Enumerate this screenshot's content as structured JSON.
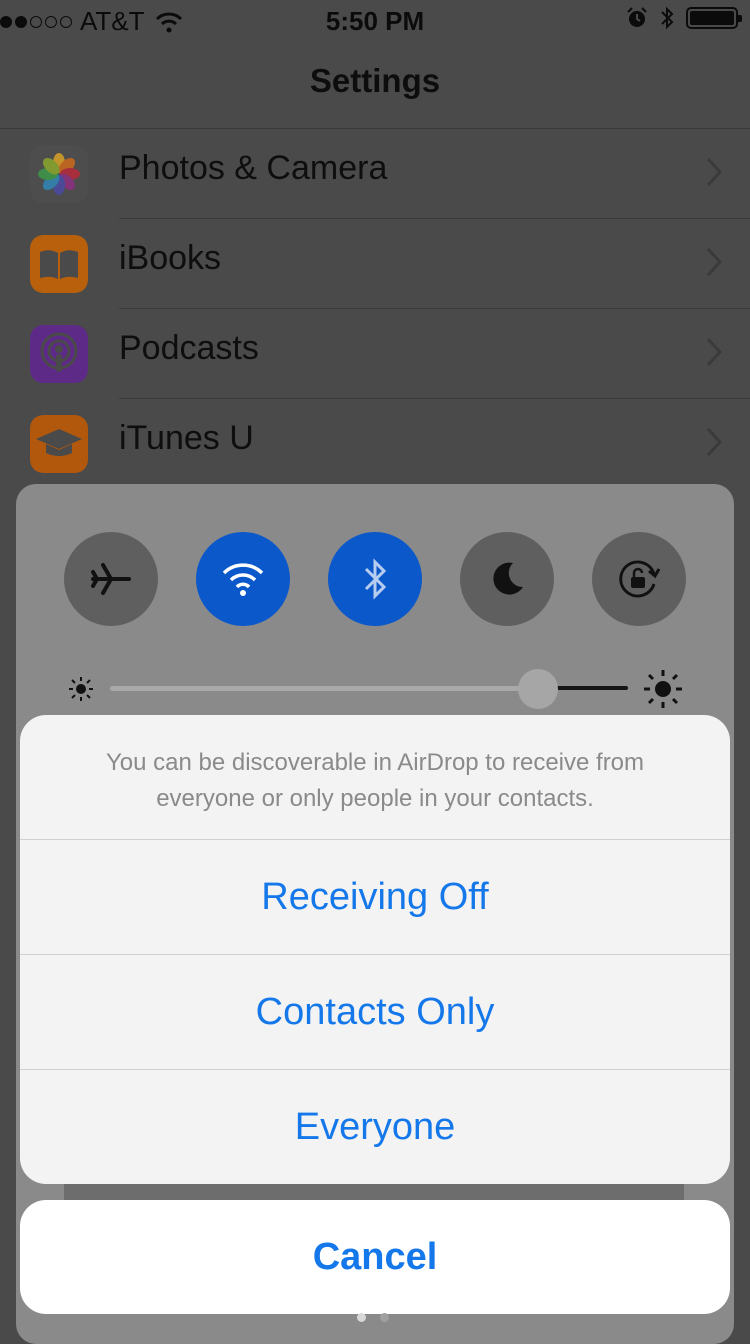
{
  "status_bar": {
    "carrier": "AT&T",
    "time": "5:50 PM",
    "signal_bars_filled": 2,
    "signal_bars_total": 5,
    "battery_level": 1.0,
    "icons": [
      "wifi-icon",
      "alarm-icon",
      "bluetooth-icon",
      "battery-icon"
    ]
  },
  "nav": {
    "title": "Settings"
  },
  "settings_rows": [
    {
      "label": "Photos & Camera",
      "icon": "photos-icon"
    },
    {
      "label": "iBooks",
      "icon": "ibooks-icon",
      "color": "#c8690a"
    },
    {
      "label": "Podcasts",
      "icon": "podcasts-icon",
      "color": "#6a2a9a"
    },
    {
      "label": "iTunes U",
      "icon": "itunes-u-icon",
      "color": "#c65e0c"
    }
  ],
  "control_center": {
    "toggles": [
      {
        "name": "airplane-mode",
        "icon": "airplane-icon",
        "on": false
      },
      {
        "name": "wifi",
        "icon": "wifi-icon",
        "on": true
      },
      {
        "name": "bluetooth",
        "icon": "bluetooth-icon",
        "on": true
      },
      {
        "name": "do-not-disturb",
        "icon": "moon-icon",
        "on": false
      },
      {
        "name": "rotation-lock",
        "icon": "rotation-lock-icon",
        "on": false
      }
    ],
    "brightness_level": 0.8,
    "accent_color": "#0a58ca"
  },
  "airdrop_sheet": {
    "message": "You can be discoverable in AirDrop to receive from everyone or only people in your contacts.",
    "options": [
      "Receiving Off",
      "Contacts Only",
      "Everyone"
    ],
    "cancel_label": "Cancel",
    "action_color": "#1578ea"
  },
  "page_indicator": {
    "pages": 2,
    "current": 1
  }
}
